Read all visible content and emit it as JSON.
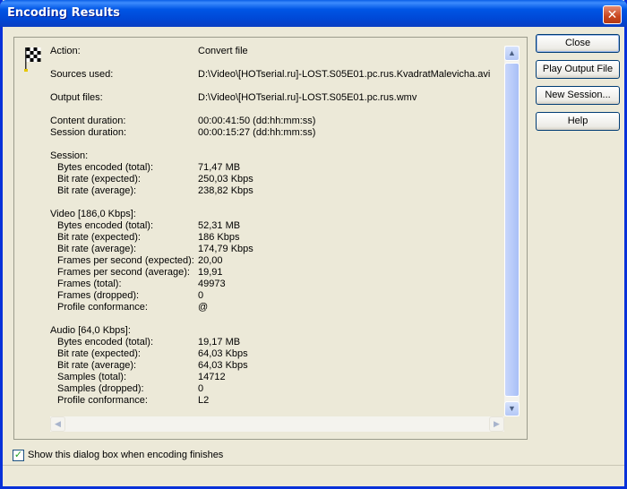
{
  "window": {
    "title": "Encoding Results",
    "close_glyph": "✕"
  },
  "results": {
    "action_label": "Action:",
    "action_value": "Convert file",
    "sources_label": "Sources used:",
    "sources_value": "D:\\Video\\[HOTserial.ru]-LOST.S05E01.pc.rus.KvadratMalevicha.avi",
    "output_label": "Output files:",
    "output_value": "D:\\Video\\[HOTserial.ru]-LOST.S05E01.pc.rus.wmv",
    "content_duration_label": "Content duration:",
    "content_duration_value": "00:00:41:50  (dd:hh:mm:ss)",
    "session_duration_label": "Session duration:",
    "session_duration_value": "00:00:15:27  (dd:hh:mm:ss)",
    "session": {
      "header": "Session:",
      "rows": [
        {
          "label": "Bytes encoded (total):",
          "value": "71,47 MB"
        },
        {
          "label": "Bit rate (expected):",
          "value": "250,03 Kbps"
        },
        {
          "label": "Bit rate (average):",
          "value": "238,82 Kbps"
        }
      ]
    },
    "video": {
      "header": "Video [186,0 Kbps]:",
      "rows": [
        {
          "label": "Bytes encoded (total):",
          "value": "52,31 MB"
        },
        {
          "label": "Bit rate (expected):",
          "value": "186 Kbps"
        },
        {
          "label": "Bit rate (average):",
          "value": "174,79 Kbps"
        },
        {
          "label": "Frames per second (expected):",
          "value": "20,00"
        },
        {
          "label": "Frames per second (average):",
          "value": "19,91"
        },
        {
          "label": "Frames (total):",
          "value": "49973"
        },
        {
          "label": "Frames (dropped):",
          "value": "0"
        },
        {
          "label": "Profile conformance:",
          "value": "@"
        }
      ]
    },
    "audio": {
      "header": "Audio [64,0 Kbps]:",
      "rows": [
        {
          "label": "Bytes encoded (total):",
          "value": "19,17 MB"
        },
        {
          "label": "Bit rate (expected):",
          "value": "64,03 Kbps"
        },
        {
          "label": "Bit rate (average):",
          "value": "64,03 Kbps"
        },
        {
          "label": "Samples (total):",
          "value": "14712"
        },
        {
          "label": "Samples (dropped):",
          "value": "0"
        },
        {
          "label": "Profile conformance:",
          "value": "L2"
        }
      ]
    }
  },
  "buttons": {
    "close": "Close",
    "play_output": "Play Output File",
    "new_session": "New Session...",
    "help": "Help"
  },
  "footer": {
    "show_dialog_label": "Show this dialog box when encoding finishes",
    "show_dialog_checked": true
  },
  "scrollbar": {
    "up_glyph": "▲",
    "down_glyph": "▼",
    "left_glyph": "◀",
    "right_glyph": "▶"
  },
  "icons": {
    "flag": "checkered-flag-icon"
  }
}
